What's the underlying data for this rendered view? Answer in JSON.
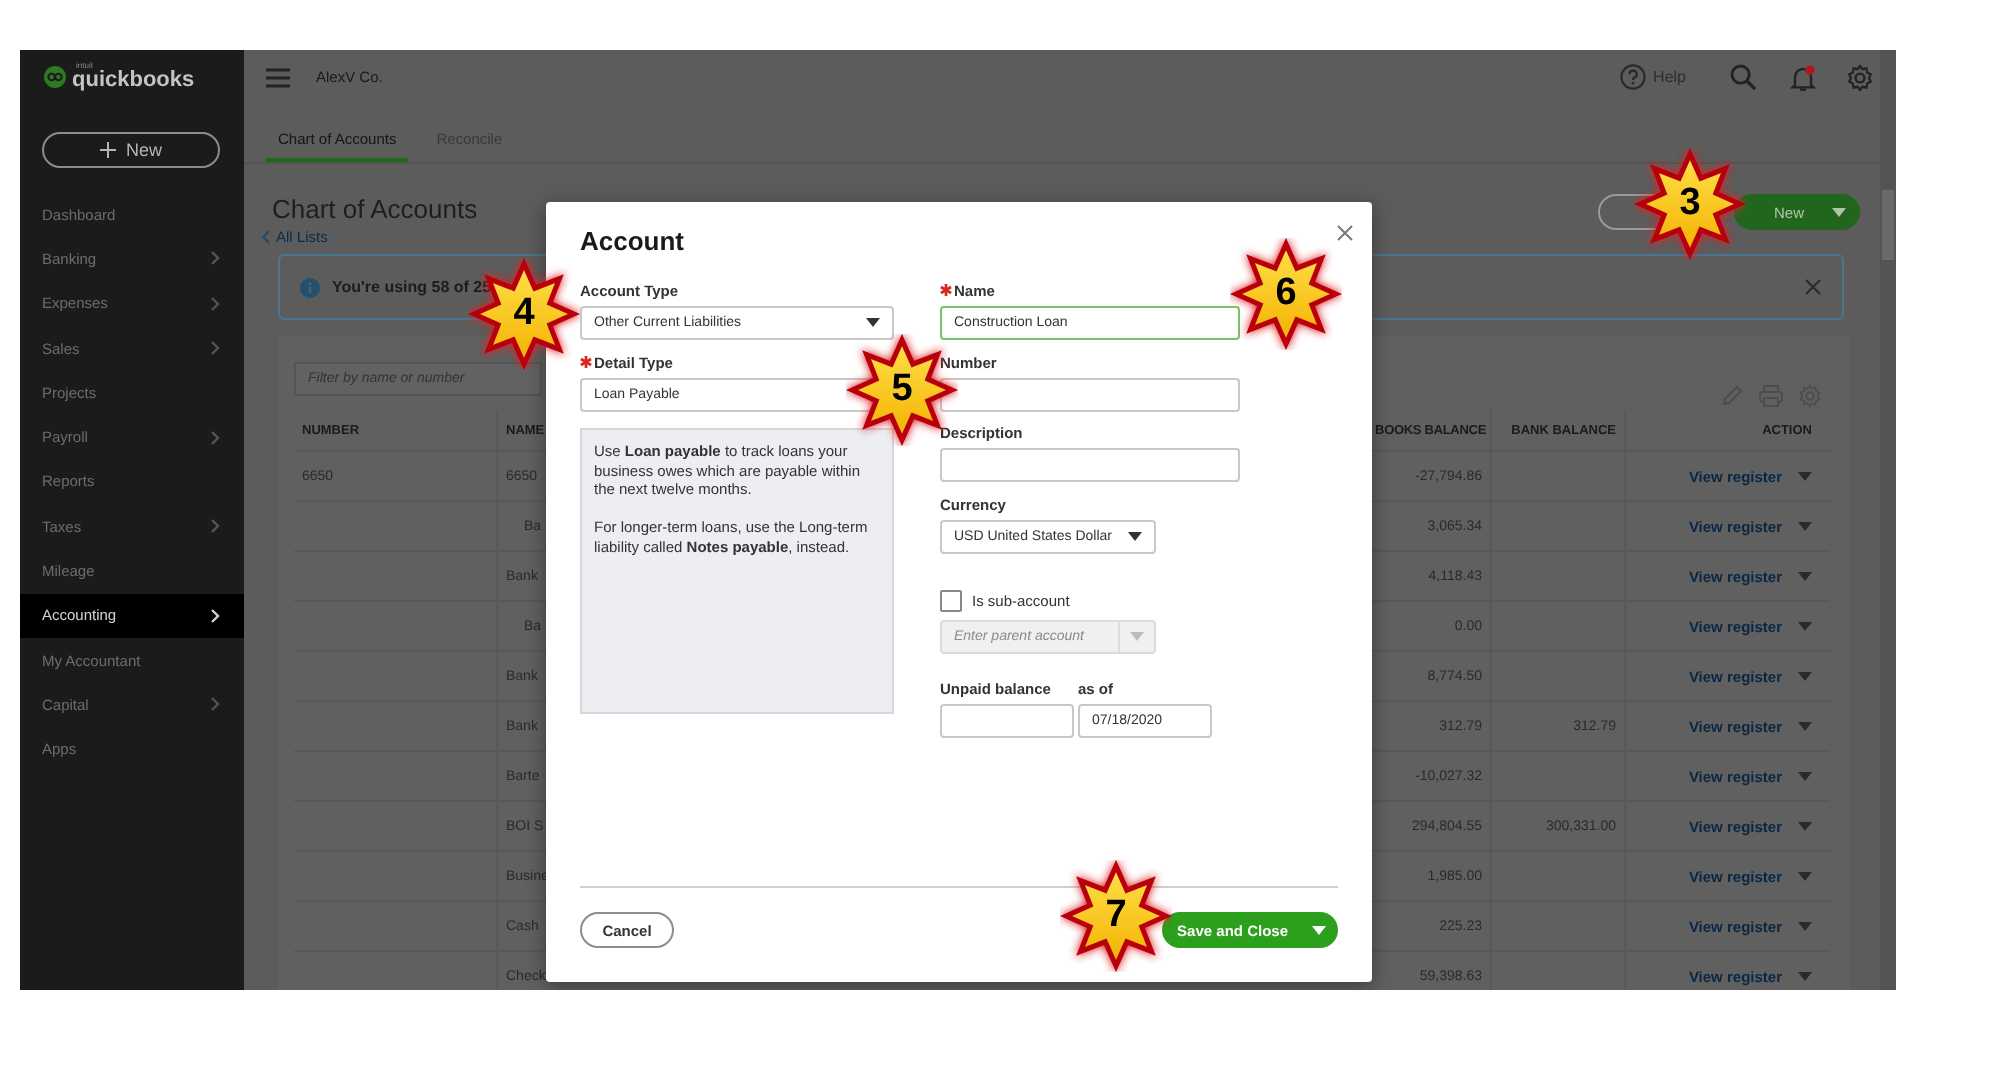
{
  "sidebar": {
    "brand_small": "intuit",
    "brand": "quickbooks",
    "new_button": "New",
    "items": [
      {
        "label": "Dashboard",
        "has_submenu": false,
        "selected": false
      },
      {
        "label": "Banking",
        "has_submenu": true,
        "selected": false
      },
      {
        "label": "Expenses",
        "has_submenu": true,
        "selected": false
      },
      {
        "label": "Sales",
        "has_submenu": true,
        "selected": false
      },
      {
        "label": "Projects",
        "has_submenu": false,
        "selected": false
      },
      {
        "label": "Payroll",
        "has_submenu": true,
        "selected": false
      },
      {
        "label": "Reports",
        "has_submenu": false,
        "selected": false
      },
      {
        "label": "Taxes",
        "has_submenu": true,
        "selected": false
      },
      {
        "label": "Mileage",
        "has_submenu": false,
        "selected": false
      },
      {
        "label": "Accounting",
        "has_submenu": true,
        "selected": true
      },
      {
        "label": "My Accountant",
        "has_submenu": false,
        "selected": false
      },
      {
        "label": "Capital",
        "has_submenu": true,
        "selected": false
      },
      {
        "label": "Apps",
        "has_submenu": false,
        "selected": false
      }
    ]
  },
  "topbar": {
    "company": "AlexV Co.",
    "help": "Help",
    "has_notification": true
  },
  "tabs": [
    {
      "label": "Chart of Accounts",
      "selected": true
    },
    {
      "label": "Reconcile",
      "selected": false
    }
  ],
  "page": {
    "title": "Chart of Accounts",
    "back_link": "All Lists",
    "buttons": [
      {
        "kind": "outline"
      },
      {
        "kind": "split",
        "label": "New"
      }
    ]
  },
  "banner": {
    "text": "You're using 58 of 25"
  },
  "table": {
    "filter_placeholder": "Filter by name or number",
    "columns": [
      "NUMBER",
      "NAME",
      "BOOKS BALANCE",
      "BANK BALANCE",
      "ACTION"
    ],
    "rows": [
      {
        "number": "6650",
        "name": "6650",
        "qb_balance": "-27,794.86",
        "action": "View register",
        "children": [
          {
            "name": "Ba",
            "qb_balance": "3,065.34",
            "action": "View register"
          }
        ]
      },
      {
        "name": "Bank",
        "qb_balance": "4,118.43",
        "action": "View register",
        "children": [
          {
            "name": "Ba",
            "qb_balance": "0.00",
            "action": "View register"
          }
        ]
      },
      {
        "name": "Bank",
        "qb_balance": "8,774.50",
        "action": "View register"
      },
      {
        "name": "Bank",
        "qb_balance": "312.79",
        "bank_balance": "312.79",
        "action": "View register"
      },
      {
        "name": "Barte",
        "qb_balance": "-10,027.32",
        "action": "View register"
      },
      {
        "name": "BOI S",
        "qb_balance": "294,804.55",
        "bank_balance": "300,331.00",
        "action": "View register"
      },
      {
        "name": "Busine",
        "qb_balance": "1,985.00",
        "action": "View register"
      },
      {
        "name": "Cash",
        "qb_balance": "225.23",
        "action": "View register"
      },
      {
        "name": "Check",
        "qb_balance": "59,398.63",
        "action": "View register"
      }
    ]
  },
  "dialog": {
    "title": "Account",
    "account_type": {
      "label": "Account Type",
      "required": false,
      "value": "Other Current Liabilities"
    },
    "detail_type": {
      "label": "Detail Type",
      "required": true,
      "value": "Loan Payable"
    },
    "help_text": [
      "Use **Loan payable** to track loans your business owes which are payable within the next twelve months.",
      "For longer-term loans, use the Long-term liability called **Notes payable**, instead."
    ],
    "name": {
      "label": "Name",
      "required": true,
      "value": "Construction Loan",
      "focused": true
    },
    "number": {
      "label": "Number",
      "required": false
    },
    "description": {
      "label": "Description",
      "required": false
    },
    "currency": {
      "label": "Currency",
      "required": false,
      "value": "USD United States Dollar"
    },
    "sub_account": {
      "label": "Is sub-account",
      "checked": false
    },
    "parent_account": {
      "placeholder": "Enter parent account",
      "disabled": true
    },
    "unpaid_balance": {
      "label": "Unpaid balance"
    },
    "as_of": {
      "label": "as of",
      "value": "07/18/2020"
    },
    "buttons": [
      {
        "kind": "secondary",
        "label": "Cancel"
      },
      {
        "kind": "split",
        "label": "Save and Close"
      }
    ]
  },
  "callouts": [
    {
      "number": "3"
    },
    {
      "number": "4"
    },
    {
      "number": "5"
    },
    {
      "number": "6"
    },
    {
      "number": "7"
    }
  ]
}
